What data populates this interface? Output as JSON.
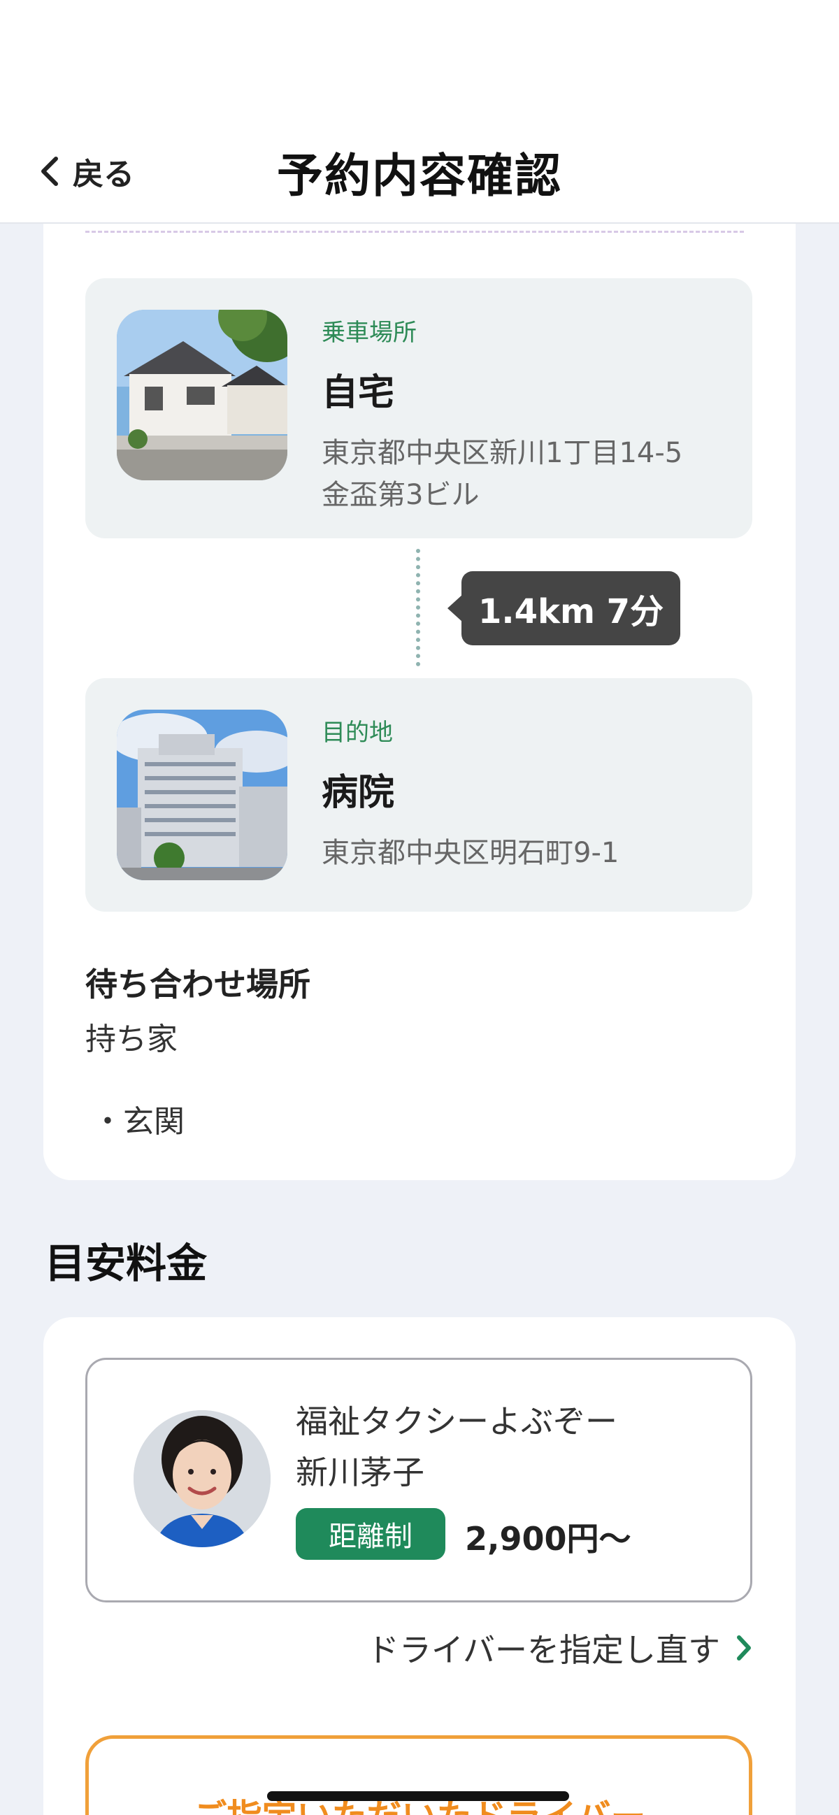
{
  "header": {
    "back_label": "戻る",
    "title": "予約内容確認"
  },
  "route": {
    "pickup": {
      "kind": "乗車場所",
      "name": "自宅",
      "address_line1": "東京都中央区新川1丁目14-5",
      "address_line2": "金盃第3ビル"
    },
    "distance": "1.4km 7分",
    "destination": {
      "kind": "目的地",
      "name": "病院",
      "address": "東京都中央区明石町9-1"
    },
    "meeting": {
      "title": "待ち合わせ場所",
      "value": "持ち家",
      "point": "・玄関"
    }
  },
  "fare": {
    "section_title": "目安料金",
    "driver": {
      "company": "福祉タクシーよぶぞー",
      "name": "新川茅子",
      "fare_type": "距離制",
      "price": "2,900円〜"
    },
    "reselect_label": "ドライバーを指定し直す",
    "designate_label": "ご指定いただいたドライバー"
  },
  "colors": {
    "accent_green": "#1f8a5b",
    "accent_orange": "#f08c1e",
    "badge_dark": "#454545"
  }
}
